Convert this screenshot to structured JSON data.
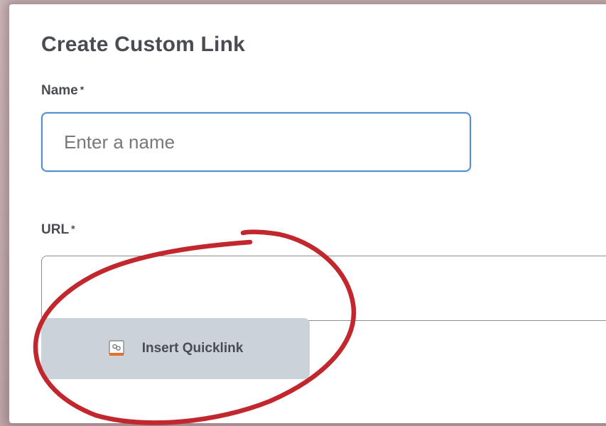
{
  "dialog": {
    "title": "Create Custom Link"
  },
  "name_field": {
    "label": "Name",
    "required_marker": "*",
    "placeholder": "Enter a name",
    "value": ""
  },
  "url_field": {
    "label": "URL",
    "required_marker": "*",
    "value": ""
  },
  "quicklink_button": {
    "label": "Insert Quicklink",
    "icon": "quicklink-icon"
  },
  "annotation": {
    "shape": "hand-drawn circle",
    "color": "#c1272d",
    "target": "quicklink_button"
  }
}
